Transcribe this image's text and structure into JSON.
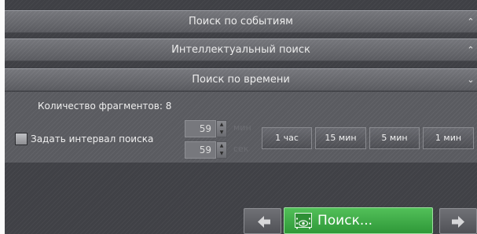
{
  "sections": {
    "event_search": {
      "title": "Поиск по событиям",
      "chevron": "⌃"
    },
    "smart_search": {
      "title": "Интеллектуальный поиск",
      "chevron": "⌃"
    },
    "time_search": {
      "title": "Поиск по времени",
      "chevron": "⌄"
    }
  },
  "time_search": {
    "fragments_label": "Количество фрагментов: 8",
    "interval_checkbox_label": "Задать интервал поиска",
    "interval_checked": false,
    "minutes": {
      "value": "59",
      "unit": "мин"
    },
    "seconds": {
      "value": "59",
      "unit": "сек"
    },
    "quick_buttons": [
      "1 час",
      "15 мин",
      "5 мин",
      "1 мин"
    ]
  },
  "footer": {
    "search_button_label": "Поиск...",
    "prev_icon": "arrow-left-icon",
    "next_icon": "arrow-right-icon",
    "search_icon": "film-eye-icon"
  },
  "colors": {
    "panel_bg": "#3f4045",
    "header_bg": "#68696e",
    "search_green": "#3fae47"
  }
}
